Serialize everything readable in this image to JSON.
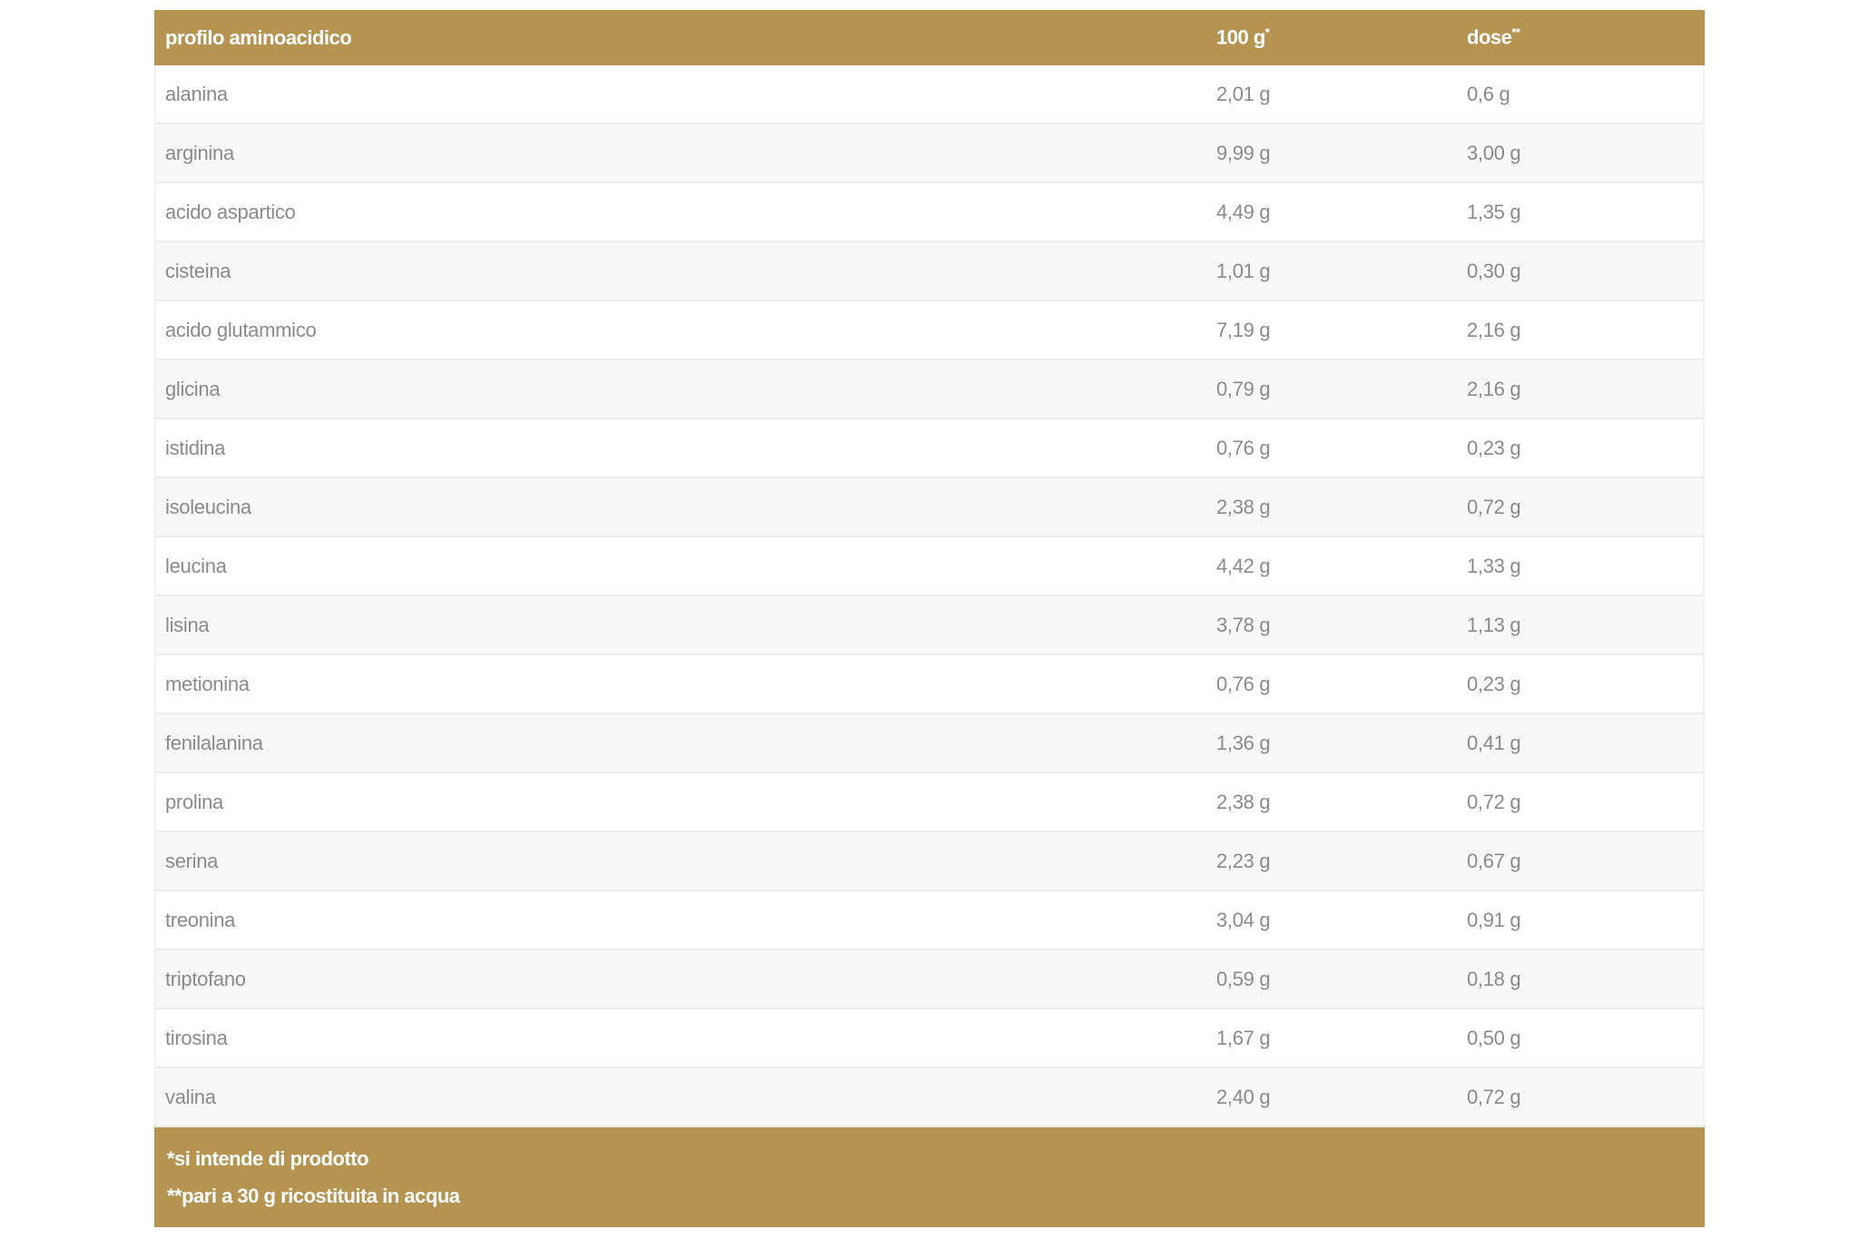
{
  "table": {
    "headers": {
      "name": "profilo aminoacidico",
      "per100": "100 g",
      "per100_mark": "*",
      "dose": "dose",
      "dose_mark": "**"
    },
    "rows": [
      {
        "name": "alanina",
        "per100": "2,01 g",
        "dose": "0,6 g"
      },
      {
        "name": "arginina",
        "per100": "9,99 g",
        "dose": "3,00 g"
      },
      {
        "name": "acido aspartico",
        "per100": "4,49 g",
        "dose": "1,35 g"
      },
      {
        "name": "cisteina",
        "per100": "1,01 g",
        "dose": "0,30 g"
      },
      {
        "name": "acido glutammico",
        "per100": "7,19 g",
        "dose": "2,16 g"
      },
      {
        "name": "glicina",
        "per100": "0,79 g",
        "dose": "2,16 g"
      },
      {
        "name": "istidina",
        "per100": "0,76 g",
        "dose": "0,23 g"
      },
      {
        "name": "isoleucina",
        "per100": "2,38 g",
        "dose": "0,72 g"
      },
      {
        "name": "leucina",
        "per100": "4,42 g",
        "dose": "1,33 g"
      },
      {
        "name": "lisina",
        "per100": "3,78 g",
        "dose": "1,13 g"
      },
      {
        "name": "metionina",
        "per100": "0,76 g",
        "dose": "0,23 g"
      },
      {
        "name": "fenilalanina",
        "per100": "1,36 g",
        "dose": "0,41 g"
      },
      {
        "name": "prolina",
        "per100": "2,38 g",
        "dose": "0,72 g"
      },
      {
        "name": "serina",
        "per100": "2,23 g",
        "dose": "0,67 g"
      },
      {
        "name": "treonina",
        "per100": "3,04 g",
        "dose": "0,91 g"
      },
      {
        "name": "triptofano",
        "per100": "0,59 g",
        "dose": "0,18 g"
      },
      {
        "name": "tirosina",
        "per100": "1,67 g",
        "dose": "0,50 g"
      },
      {
        "name": "valina",
        "per100": "2,40 g",
        "dose": "0,72 g"
      }
    ],
    "footnotes": [
      "*si intende di prodotto",
      "**pari a 30 g ricostituita in acqua"
    ]
  },
  "colors": {
    "accent": "#b59452",
    "text": "#8a8a8a",
    "row_alt": "#f8f8f8"
  }
}
